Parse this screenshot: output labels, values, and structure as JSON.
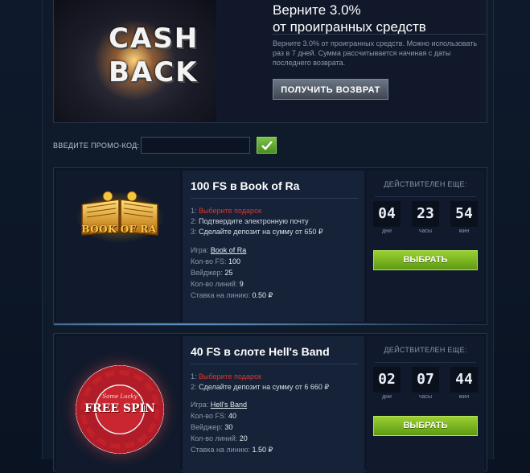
{
  "cashback": {
    "image_text_line1": "CASH",
    "image_text_line2": "BACK",
    "title_line1": "Верните 3.0%",
    "title_line2": "от проигранных средств",
    "description": "Верните 3.0% от проигранных средств. Можно использовать раз в 7 дней. Сумма рассчитывается начиная с даты последнего возврата.",
    "button_label": "ПОЛУЧИТЬ ВОЗВРАТ"
  },
  "promo": {
    "label": "ВВЕДИТЕ ПРОМО-КОД:",
    "value": ""
  },
  "offers": [
    {
      "logo_text": "BOOK OF RA",
      "title": "100 FS в Book of Ra",
      "steps": [
        {
          "num": "1:",
          "text": "Выберите подарок"
        },
        {
          "num": "2:",
          "text": "Подтвердите электронную почту"
        },
        {
          "num": "3:",
          "text": "Сделайте депозит на сумму от 650 ₽"
        }
      ],
      "props": [
        {
          "key": "Игра: ",
          "value": "Book of Ra"
        },
        {
          "key": "Кол-во FS: ",
          "value": "100"
        },
        {
          "key": "Вейджер: ",
          "value": "25"
        },
        {
          "key": "Кол-во линий: ",
          "value": "9"
        },
        {
          "key": "Ставка на линию: ",
          "value": "0.50 ₽"
        }
      ],
      "timer_label": "ДЕЙСТВИТЕЛЕН ЕЩЕ:",
      "timer": [
        {
          "value": "04",
          "unit": "дни"
        },
        {
          "value": "23",
          "unit": "часы"
        },
        {
          "value": "54",
          "unit": "мин"
        }
      ],
      "button_label": "ВЫБРАТЬ"
    },
    {
      "logo_text": "FREE SPIN",
      "logo_sub": "Some Lucky",
      "title": "40 FS в слоте Hell's Band",
      "steps": [
        {
          "num": "1:",
          "text": "Выберите подарок"
        },
        {
          "num": "2:",
          "text": "Сделайте депозит на сумму от 6 660 ₽"
        }
      ],
      "props": [
        {
          "key": "Игра: ",
          "value": "Hell's Band"
        },
        {
          "key": "Кол-во FS: ",
          "value": "40"
        },
        {
          "key": "Вейджер: ",
          "value": "30"
        },
        {
          "key": "Кол-во линий: ",
          "value": "20"
        },
        {
          "key": "Ставка на линию: ",
          "value": "1.50 ₽"
        }
      ],
      "timer_label": "ДЕЙСТВИТЕЛЕН ЕЩЕ:",
      "timer": [
        {
          "value": "02",
          "unit": "дни"
        },
        {
          "value": "07",
          "unit": "часы"
        },
        {
          "value": "44",
          "unit": "мин"
        }
      ],
      "button_label": "ВЫБРАТЬ"
    }
  ]
}
